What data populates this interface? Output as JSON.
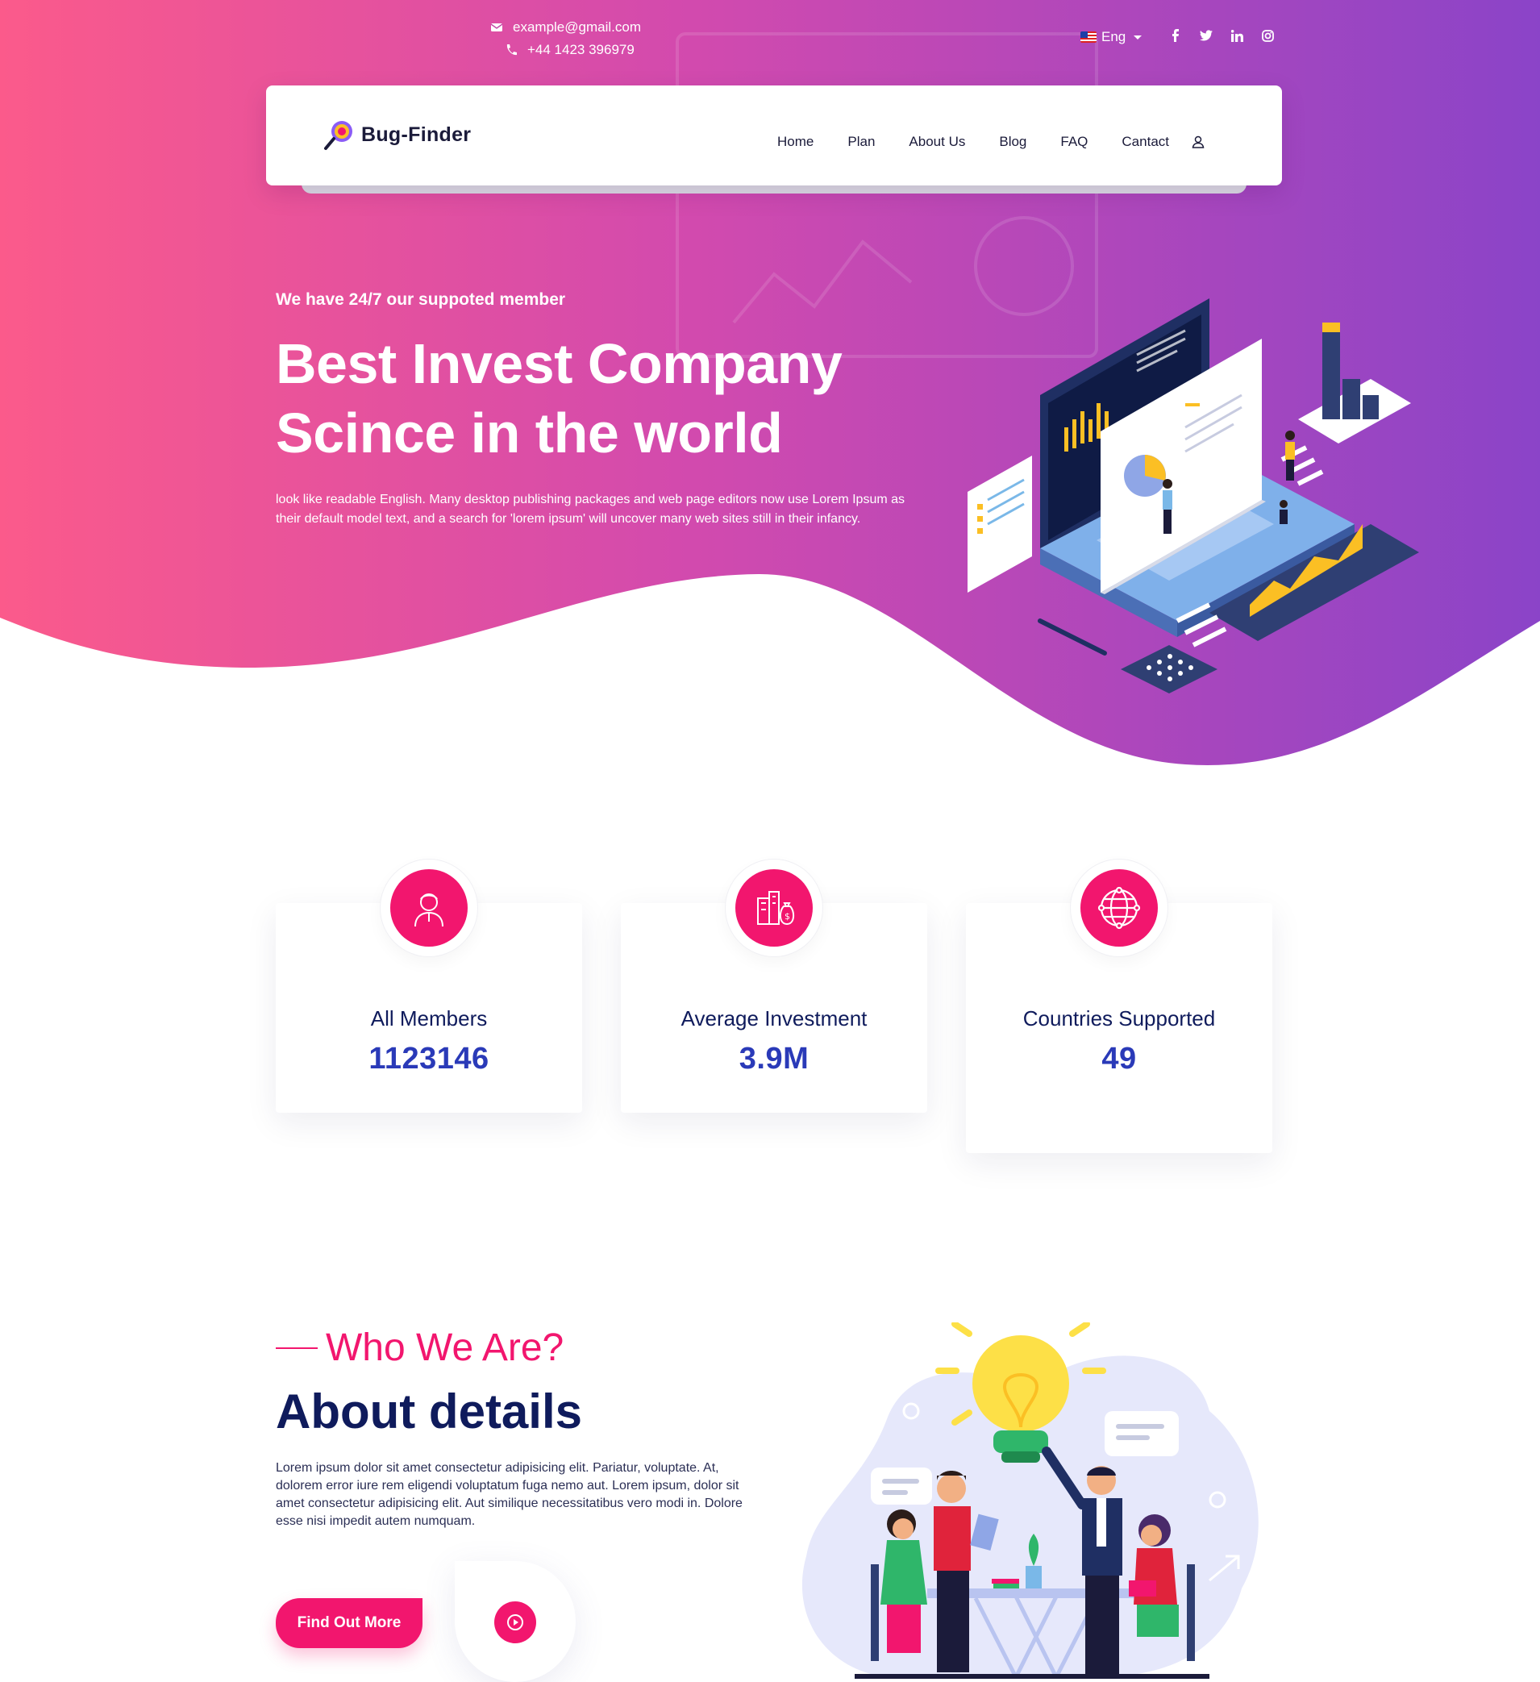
{
  "header": {
    "email": "example@gmail.com",
    "phone": "+44 1423 396979",
    "language": "Eng",
    "socials": [
      "facebook-icon",
      "twitter-icon",
      "linkedin-icon",
      "instagram-icon"
    ]
  },
  "nav": {
    "logo_text": "Bug-Finder",
    "items": [
      "Home",
      "Plan",
      "About Us",
      "Blog",
      "FAQ",
      "Cantact"
    ]
  },
  "hero": {
    "tagline": "We have 24/7 our suppoted member",
    "title_line1": "Best Invest Company",
    "title_line2": "Scince in the world",
    "description": "look like readable English. Many desktop publishing packages and web page editors now use Lorem Ipsum as their default model text, and a search for 'lorem ipsum' will uncover many web sites still in their infancy."
  },
  "stats": [
    {
      "label": "All Members",
      "value": "1123146",
      "icon": "member-icon"
    },
    {
      "label": "Average Investment",
      "value": "3.9M",
      "icon": "investment-icon"
    },
    {
      "label": "Countries Supported",
      "value": "49",
      "icon": "globe-icon"
    }
  ],
  "about": {
    "subtitle": "Who We Are?",
    "title": "About details",
    "description": "Lorem ipsum dolor sit amet consectetur adipisicing elit. Pariatur, voluptate. At, dolorem error iure rem eligendi voluptatum fuga nemo aut. Lorem ipsum, dolor sit amet consectetur adipisicing elit. Aut similique necessitatibus vero modi in. Dolore esse nisi impedit autem numquam.",
    "button_label": "Find Out More"
  },
  "colors": {
    "accent": "#f2166e",
    "hero_gradient_start": "#fb5a8b",
    "hero_gradient_end": "#8b44c8",
    "heading": "#0f1b5c",
    "stat_value": "#2a3ab8"
  }
}
